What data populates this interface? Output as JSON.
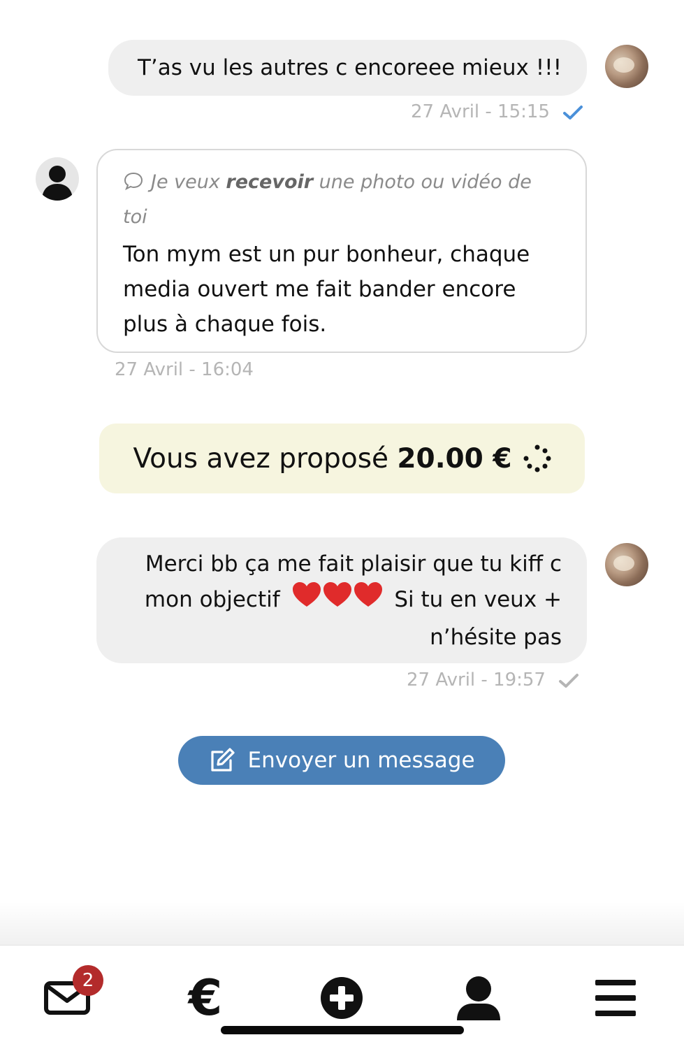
{
  "messages": [
    {
      "text": "T’as vu les autres c encoreee mieux !!!",
      "meta": "27 Avril - 15:15"
    },
    {
      "request_prefix": "Je veux ",
      "request_bold": "recevoir",
      "request_suffix": " une photo ou vidéo de",
      "request_line2": "toi",
      "text_lines": [
        "Ton mym est un pur bonheur, chaque",
        "media ouvert me fait bander encore",
        "plus à chaque fois."
      ],
      "meta": "27 Avril - 16:04"
    },
    {
      "text_lines": [
        "Merci bb ça me fait plaisir que tu kiff c",
        "mon objectif",
        "Si tu en veux +",
        "n’hésite pas"
      ],
      "meta": "27 Avril - 19:57"
    }
  ],
  "offer": {
    "prefix": "Vous avez proposé ",
    "amount": "20.00 €"
  },
  "send_button": {
    "label": "Envoyer un message"
  },
  "nav": {
    "messages_badge": "2",
    "euro_symbol": "€"
  },
  "colors": {
    "accent": "#4a80b7",
    "badge": "#b32b2b",
    "offer_bg": "#f6f5df",
    "read_check": "#4a90d9",
    "sent_check": "#b5b5b5"
  },
  "icons": [
    "chat-bubble-icon",
    "check-icon",
    "spinner-icon",
    "edit-icon",
    "envelope-icon",
    "euro-icon",
    "plus-circle-icon",
    "user-icon",
    "menu-icon"
  ]
}
